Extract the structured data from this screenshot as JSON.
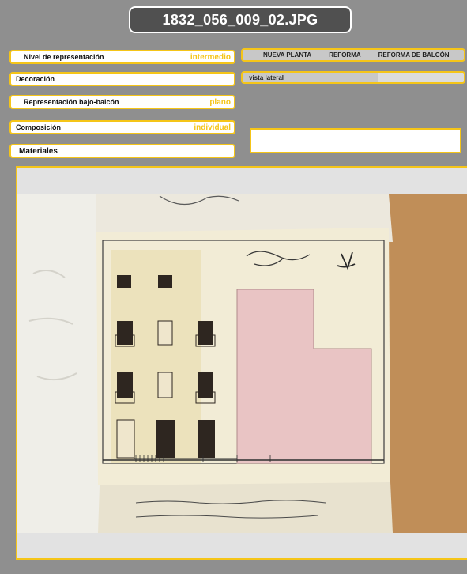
{
  "header": {
    "filename": "1832_056_009_02.JPG"
  },
  "fields": {
    "nivel": {
      "label": "Nivel de representación",
      "value": "intermedio"
    },
    "decoracion": {
      "label": "Decoración",
      "value": ""
    },
    "bajo_balcon": {
      "label": "Representación bajo-balcón",
      "value": "plano"
    },
    "composicion": {
      "label": "Composición",
      "value": "individual"
    },
    "materiales": {
      "label": "Materiales",
      "value": ""
    }
  },
  "tags": [
    "NUEVA PLANTA",
    "REFORMA",
    "REFORMA DE BALCÓN"
  ],
  "view": {
    "label": "vista lateral"
  },
  "note": {
    "text": ""
  },
  "image": {
    "icon": "architectural-drawing-photo"
  },
  "colors": {
    "accent": "#f5c518",
    "background": "#8f8f8f",
    "title_bg": "#505050"
  }
}
